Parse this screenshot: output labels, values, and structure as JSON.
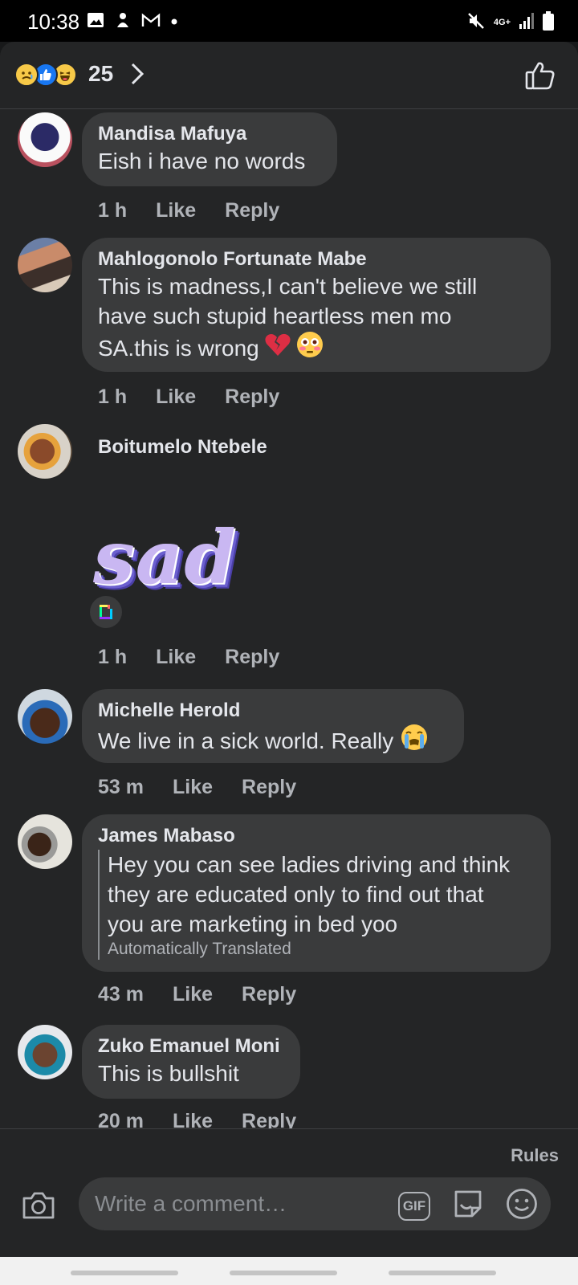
{
  "status_bar": {
    "time": "10:38",
    "network": "4G+"
  },
  "header": {
    "reaction_count": "25"
  },
  "comments": [
    {
      "author": "Mandisa Mafuya",
      "text": "Eish i have no words",
      "time": "1 h"
    },
    {
      "author": "Mahlogonolo Fortunate Mabe",
      "text_lines": [
        "This is madness,I can't believe we still",
        "have such stupid heartless men mo",
        "SA.this is wrong"
      ],
      "time": "1 h"
    },
    {
      "author": "Boitumelo Ntebele",
      "sticker_text": "sad",
      "time": "1 h"
    },
    {
      "author": "Michelle Herold",
      "text": "We live in a sick world. Really",
      "time": "53 m"
    },
    {
      "author": "James Mabaso",
      "text_lines": [
        "Hey you can see ladies driving and think",
        "they are educated only to find out that",
        "you are marketing in bed yoo"
      ],
      "translated_label": "Automatically Translated",
      "time": "43 m"
    },
    {
      "author": "Zuko Emanuel Moni",
      "text": "This is bullshit",
      "time": "20 m"
    }
  ],
  "actions": {
    "like": "Like",
    "reply": "Reply"
  },
  "composer": {
    "rules_label": "Rules",
    "placeholder": "Write a comment…",
    "gif_label": "GIF"
  }
}
